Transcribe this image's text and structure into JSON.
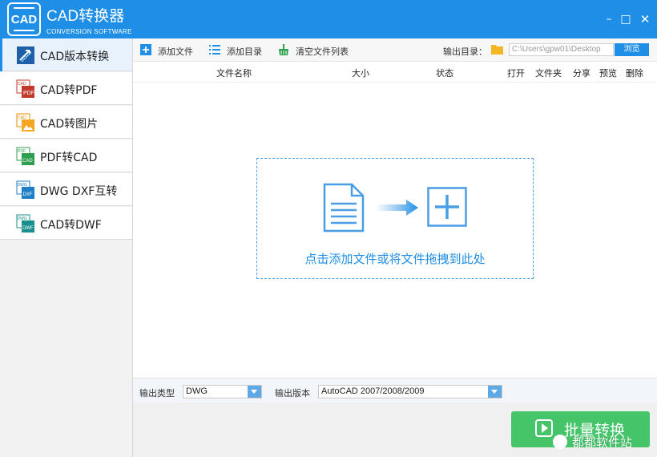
{
  "window": {
    "logo_text": "CAD",
    "title": "CAD转换器",
    "subtitle": "CONVERSION SOFTWARE",
    "minimize": "–",
    "maximize": "□",
    "close": "✕"
  },
  "sidebar": {
    "items": [
      {
        "label": "CAD版本转换",
        "icon": "cad-version-icon",
        "active": true
      },
      {
        "label": "CAD转PDF",
        "icon": "cad-to-pdf-icon"
      },
      {
        "label": "CAD转图片",
        "icon": "cad-to-image-icon"
      },
      {
        "label": "PDF转CAD",
        "icon": "pdf-to-cad-icon"
      },
      {
        "label": "DWG DXF互转",
        "icon": "dwg-dxf-icon"
      },
      {
        "label": "CAD转DWF",
        "icon": "cad-to-dwf-icon"
      }
    ]
  },
  "toolbar": {
    "add_file": "添加文件",
    "add_folder": "添加目录",
    "clear_list": "清空文件列表",
    "output_label": "输出目录：",
    "output_path": "C:\\Users\\gpw01\\Desktop",
    "browse": "浏览"
  },
  "table": {
    "columns": [
      "文件名称",
      "大小",
      "状态",
      "打开",
      "文件夹",
      "分享",
      "预览",
      "删除"
    ]
  },
  "dropzone": {
    "text": "点击添加文件或将文件拖拽到此处"
  },
  "options": {
    "output_type_label": "输出类型",
    "output_type_value": "DWG",
    "output_version_label": "输出版本",
    "output_version_value": "AutoCAD 2007/2008/2009"
  },
  "convert": {
    "label": "批量转换"
  },
  "watermark": {
    "text": "都都软件站"
  },
  "colors": {
    "accent": "#1e8ee6",
    "convert_green": "#45c46a"
  }
}
